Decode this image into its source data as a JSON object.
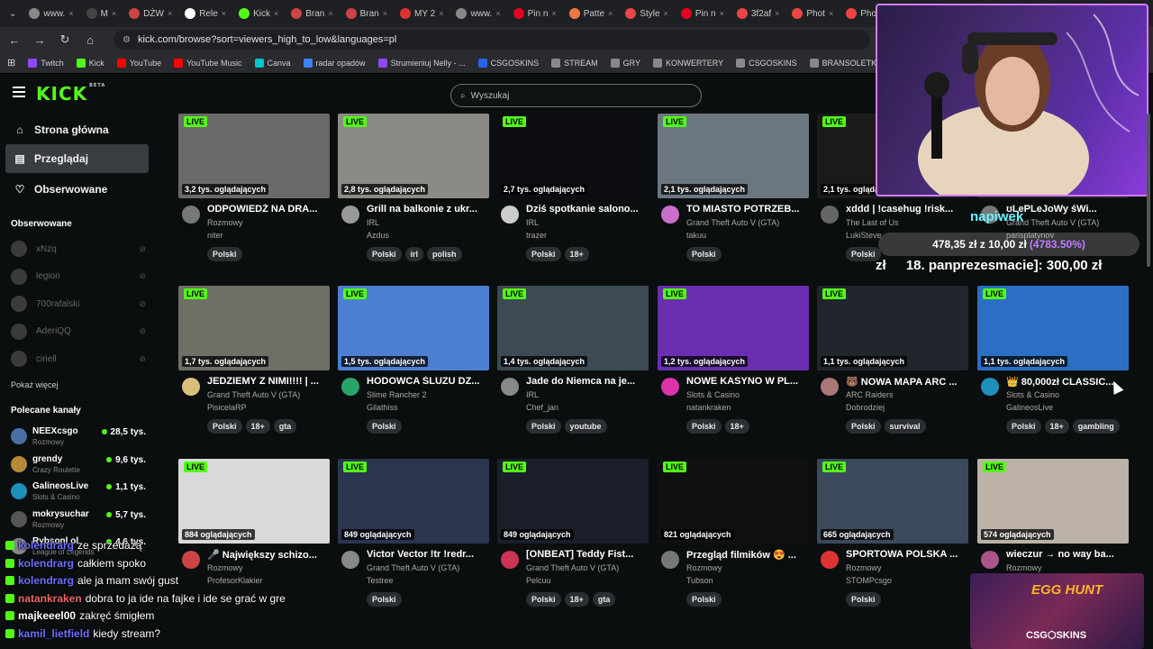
{
  "browser": {
    "tabs": [
      {
        "label": "www.",
        "color": "#888"
      },
      {
        "label": "M",
        "color": "#444"
      },
      {
        "label": "DŻW",
        "color": "#c44"
      },
      {
        "label": "Rele",
        "color": "#fff"
      },
      {
        "label": "Kick",
        "color": "#53fc18"
      },
      {
        "label": "Bran",
        "color": "#c44"
      },
      {
        "label": "Bran",
        "color": "#c44"
      },
      {
        "label": "MY 2",
        "color": "#d33"
      },
      {
        "label": "www.",
        "color": "#888"
      },
      {
        "label": "Pin n",
        "color": "#e60023"
      },
      {
        "label": "Patte",
        "color": "#e74"
      },
      {
        "label": "Style",
        "color": "#e44"
      },
      {
        "label": "Pin n",
        "color": "#e60023"
      },
      {
        "label": "3f2af",
        "color": "#e44"
      },
      {
        "label": "Phot",
        "color": "#e44"
      },
      {
        "label": "Phot",
        "color": "#e44"
      },
      {
        "label": "Pinte",
        "color": "#e60023"
      },
      {
        "label": "(2) Tı",
        "color": "#888"
      },
      {
        "label": "Strea",
        "color": "#53fc18"
      }
    ],
    "url": "kick.com/browse?sort=viewers_high_to_low&languages=pl",
    "bookmarks": [
      {
        "label": "Twitch",
        "color": "#9146ff"
      },
      {
        "label": "Kick",
        "color": "#53fc18"
      },
      {
        "label": "YouTube",
        "color": "#f00"
      },
      {
        "label": "YouTube Music",
        "color": "#f00"
      },
      {
        "label": "Canva",
        "color": "#00c4cc"
      },
      {
        "label": "radar opadów",
        "color": "#3b82f6"
      },
      {
        "label": "Strumieniuj Nelly - ...",
        "color": "#9146ff"
      },
      {
        "label": "CSGOSKINS",
        "color": "#2563eb"
      },
      {
        "label": "STREAM",
        "color": "#888"
      },
      {
        "label": "GRY",
        "color": "#888"
      },
      {
        "label": "KONWERTERY",
        "color": "#888"
      },
      {
        "label": "CSGOSKINS",
        "color": "#888"
      },
      {
        "label": "BRANSOLETKI",
        "color": "#888"
      },
      {
        "label": "Ustawienia strumien...",
        "color": "#e44"
      }
    ]
  },
  "app": {
    "logo": "KICK",
    "logo_sup": "BETA",
    "search_placeholder": "Wyszukaj"
  },
  "sidebar": {
    "nav": [
      {
        "label": "Strona główna",
        "icon": "home-icon"
      },
      {
        "label": "Przeglądaj",
        "icon": "browse-icon"
      },
      {
        "label": "Obserwowane",
        "icon": "heart-icon"
      }
    ],
    "following_heading": "Obserwowane",
    "following": [
      "xNzq",
      "legion",
      "700rafalski",
      "AderiQQ",
      "ciriell"
    ],
    "show_more": "Pokaż więcej",
    "recommended_heading": "Polecane kanały",
    "recommended": [
      {
        "name": "NEEXcsgo",
        "category": "Rozmowy",
        "viewers": "28,5 tys.",
        "color": "#4a6fa5"
      },
      {
        "name": "grendy",
        "category": "Crazy Roulette",
        "viewers": "9,6 tys.",
        "color": "#b58b3a"
      },
      {
        "name": "GalineosLive",
        "category": "Slots & Casino",
        "viewers": "1,1 tys.",
        "color": "#1d8fb8"
      },
      {
        "name": "mokrysuchar",
        "category": "Rozmowy",
        "viewers": "5,7 tys.",
        "color": "#555"
      },
      {
        "name": "Rybsonl ol",
        "category": "League of Legends",
        "viewers": "4,6 tys.",
        "color": "#888"
      }
    ]
  },
  "live_label": "LIVE",
  "streams": [
    {
      "viewers": "3,2 tys. oglądających",
      "title": "ODPOWIEDŹ NA DRA...",
      "category": "Rozmowy",
      "channel": "niter",
      "tags": [
        "Polski"
      ],
      "thumb": "#6a6a6a",
      "avatar": "#777"
    },
    {
      "viewers": "2,8 tys. oglądających",
      "title": "Grill na balkonie z ukr...",
      "category": "IRL",
      "channel": "Azdus",
      "tags": [
        "Polski",
        "irl",
        "polish"
      ],
      "thumb": "#8c8a84",
      "avatar": "#999"
    },
    {
      "viewers": "2,7 tys. oglądających",
      "title": "Dziś spotkanie salono...",
      "category": "IRL",
      "channel": "trazer",
      "tags": [
        "Polski",
        "18+"
      ],
      "thumb": "#0c0d12",
      "avatar": "#ccc"
    },
    {
      "viewers": "2,1 tys. oglądających",
      "title": "TO MIASTO POTRZEB...",
      "category": "Grand Theft Auto V (GTA)",
      "channel": "takuu",
      "tags": [
        "Polski"
      ],
      "thumb": "#6b7680",
      "avatar": "#c96fc9"
    },
    {
      "viewers": "2,1 tys. oglądających",
      "title": "xddd | !casehug !risk...",
      "category": "The Last of Us",
      "channel": "LukiSteve",
      "tags": [
        "Polski"
      ],
      "thumb": "#1a1a1a",
      "avatar": "#666"
    },
    {
      "viewers": "",
      "title": "ʊLePLeJoWy śWi...",
      "category": "Grand Theft Auto V (GTA)",
      "channel": "parisplatynov",
      "tags": [],
      "thumb": "#222",
      "avatar": "#777"
    },
    {
      "viewers": "1,7 tys. oglądających",
      "title": "JEDZIEMY Z NIMI!!!! | ...",
      "category": "Grand Theft Auto V (GTA)",
      "channel": "PisicelaRP",
      "tags": [
        "Polski",
        "18+",
        "gta"
      ],
      "thumb": "#6e6f65",
      "avatar": "#d8c07a"
    },
    {
      "viewers": "1,5 tys. oglądających",
      "title": "HODOWCA ŚLUZU DZ...",
      "category": "Slime Rancher 2",
      "channel": "Gilathiss",
      "tags": [
        "Polski"
      ],
      "thumb": "#4c7fd1",
      "avatar": "#2aa36b"
    },
    {
      "viewers": "1,4 tys. oglądających",
      "title": "Jade do Niemca na je...",
      "category": "IRL",
      "channel": "Chef_jan",
      "tags": [
        "Polski",
        "youtube"
      ],
      "thumb": "#3c4a55",
      "avatar": "#888"
    },
    {
      "viewers": "1,2 tys. oglądających",
      "title": "NOWE KASYNO W PL...",
      "category": "Slots & Casino",
      "channel": "natankraken",
      "tags": [
        "Polski",
        "18+"
      ],
      "thumb": "#6a2fb0",
      "avatar": "#d3a"
    },
    {
      "viewers": "1,1 tys. oglądających",
      "title": "🐻 NOWA MAPA ARC ...",
      "category": "ARC Raiders",
      "channel": "Dobrodziej",
      "tags": [
        "Polski",
        "survival"
      ],
      "thumb": "#20262c",
      "avatar": "#a77"
    },
    {
      "viewers": "1,1 tys. oglądających",
      "title": "👑 80,000zł CLASSIC...",
      "category": "Slots & Casino",
      "channel": "GalineosLive",
      "tags": [
        "Polski",
        "18+",
        "gambling"
      ],
      "thumb": "#2a6fc4",
      "avatar": "#1d8fb8"
    },
    {
      "viewers": "884 oglądających",
      "title": "🎤 Największy schizo...",
      "category": "Rozmowy",
      "channel": "ProfesorKlakier",
      "tags": [],
      "thumb": "#d9d9d9",
      "avatar": "#c44"
    },
    {
      "viewers": "849 oglądających",
      "title": "Victor Vector !tr !redr...",
      "category": "Grand Theft Auto V (GTA)",
      "channel": "Testree",
      "tags": [
        "Polski"
      ],
      "thumb": "#2b3550",
      "avatar": "#888"
    },
    {
      "viewers": "849 oglądających",
      "title": "[ONBEAT] Teddy Fist...",
      "category": "Grand Theft Auto V (GTA)",
      "channel": "Pelcuu",
      "tags": [
        "Polski",
        "18+",
        "gta"
      ],
      "thumb": "#1a1f2a",
      "avatar": "#c35"
    },
    {
      "viewers": "821 oglądających",
      "title": "Przegląd filmików 😍 ...",
      "category": "Rozmowy",
      "channel": "Tubson",
      "tags": [
        "Polski"
      ],
      "thumb": "#101010",
      "avatar": "#777"
    },
    {
      "viewers": "665 oglądających",
      "title": "SPORTOWA POLSKA ...",
      "category": "Rozmowy",
      "channel": "STOMPcsgo",
      "tags": [
        "Polski"
      ],
      "thumb": "#3a4a5a",
      "avatar": "#d33"
    },
    {
      "viewers": "574 oglądających",
      "title": "wieczur → no way ba...",
      "category": "Rozmowy",
      "channel": "",
      "tags": [],
      "thumb": "#bcb2a8",
      "avatar": "#a58"
    }
  ],
  "overlay": {
    "napiwek": "napiwek",
    "donation_amount": "478,35 zł z 10,00 zł",
    "donation_pct": "(4783.50%)",
    "counter_prefix": "zł",
    "counter_text": "18. panprezesmacie]: 300,00 zł",
    "chat": [
      {
        "user": "kolendrarg",
        "text": "ze sprzedażą",
        "color": "#6f6fff"
      },
      {
        "user": "kolendrarg",
        "text": "całkiem spoko",
        "color": "#6f6fff"
      },
      {
        "user": "kolendrarg",
        "text": "ale ja mam swój gust",
        "color": "#6f6fff"
      },
      {
        "user": "natankraken",
        "text": "dobra to ja ide na fajke i ide se grać w gre",
        "color": "#e66"
      },
      {
        "user": "majkeeel00",
        "text": "zakręć śmigłem",
        "color": "#fff"
      },
      {
        "user": "kamil_lietfield",
        "text": "kiedy stream?",
        "color": "#6f6fff"
      }
    ],
    "egg_title": "EGG HUNT",
    "egg_brand": "CSG⬡SKINS"
  }
}
